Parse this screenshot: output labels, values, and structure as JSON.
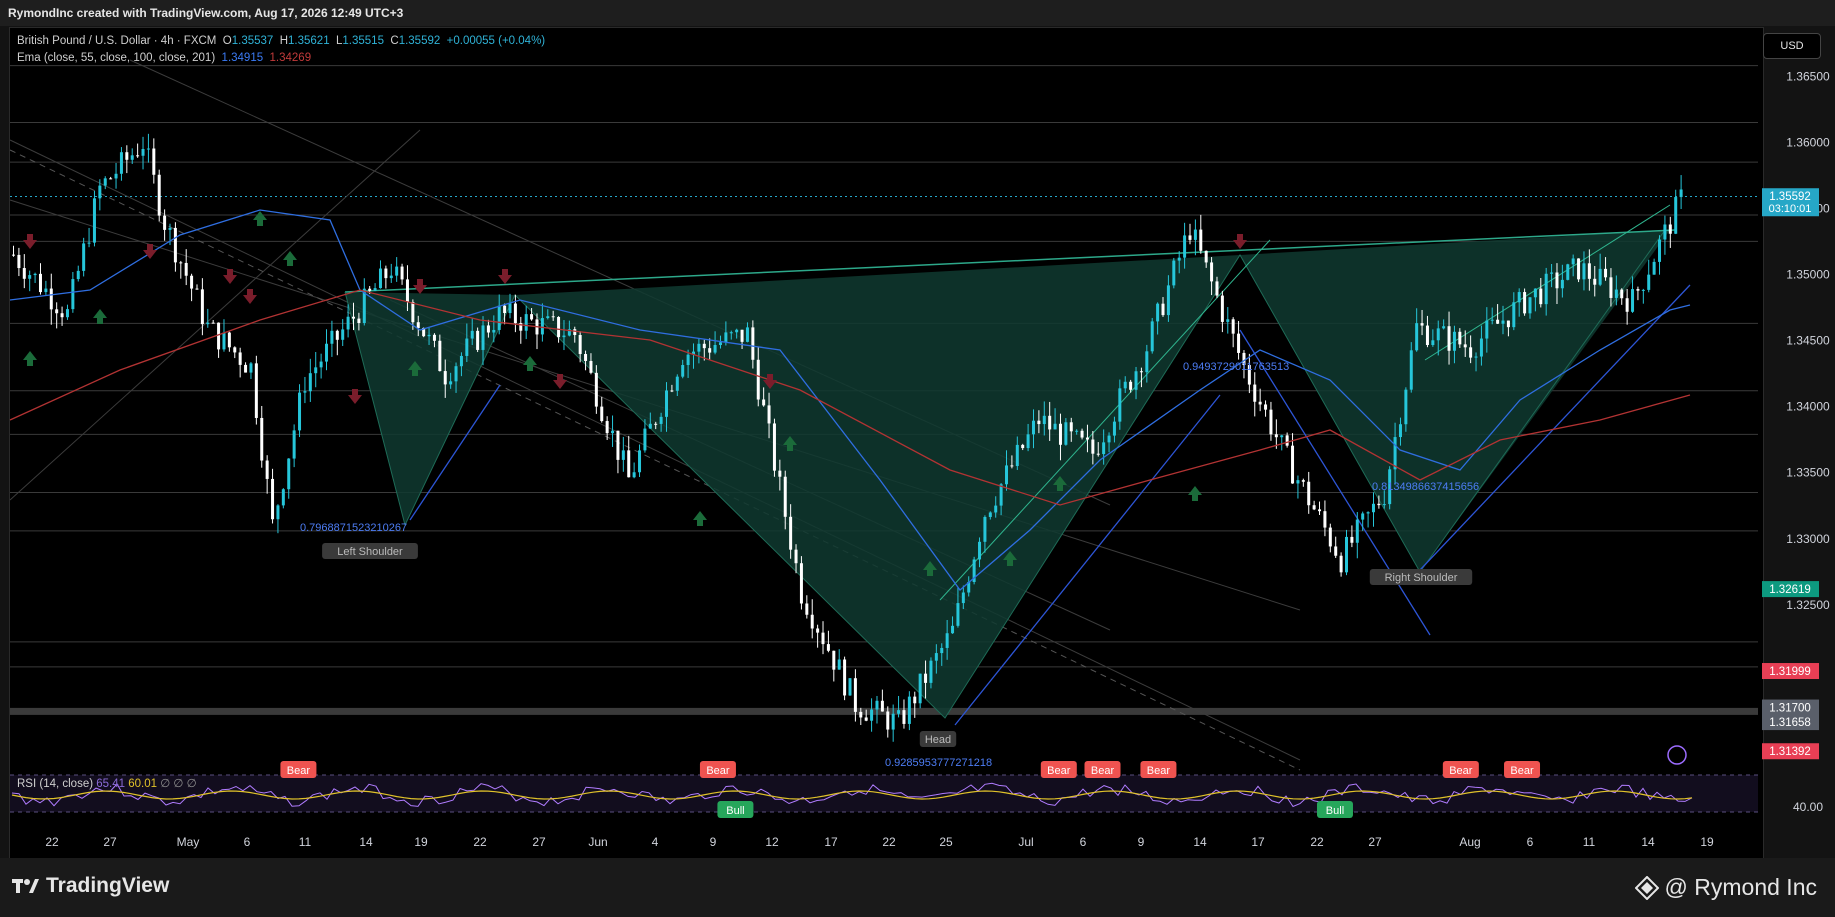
{
  "header": {
    "credit": "RymondInc created with TradingView.com, Aug 17, 2026 12:49 UTC+3",
    "symbol": "British Pound / U.S. Dollar · 4h · FXCM",
    "o_label": "O",
    "o_value": "1.35537",
    "h_label": "H",
    "h_value": "1.35621",
    "l_label": "L",
    "l_value": "1.35515",
    "c_label": "C",
    "c_value": "1.35592",
    "change": "+0.00055 (+0.04%)",
    "ema_label": "Ema (close, 55, close, 100, close, 201)",
    "ema_val1": "1.34915",
    "ema_val2": "1.34269",
    "currency_button": "USD"
  },
  "footer": {
    "brand": "TradingView",
    "author": "@ Rymond Inc"
  },
  "colors": {
    "background": "#000000",
    "up_candle": "#26c6da",
    "down_candle": "#ffffff",
    "pattern_fill": "#0f3a30",
    "ema55": "#2f6ee0",
    "ema201": "#b23333",
    "bear_label": "#ef5350",
    "bull_label": "#26a65b",
    "rsi_line": "#b07cff",
    "rsi_ma": "#e0c22a"
  },
  "chart_data": {
    "type": "candlestick",
    "title": "British Pound / U.S. Dollar · 4h · FXCM",
    "x_ticks": [
      "22",
      "27",
      "May",
      "6",
      "11",
      "14",
      "19",
      "22",
      "27",
      "Jun",
      "4",
      "9",
      "12",
      "17",
      "22",
      "25",
      "Jul",
      "6",
      "9",
      "14",
      "17",
      "22",
      "27",
      "Aug",
      "6",
      "11",
      "14",
      "19"
    ],
    "y_ticks": [
      "1.36500",
      "1.36000",
      "1.35500",
      "1.35000",
      "1.34500",
      "1.34000",
      "1.33500",
      "1.33000",
      "1.32500"
    ],
    "ylim": [
      1.3125,
      1.3685
    ],
    "price_tags": [
      {
        "price": 1.35592,
        "label": "1.35592",
        "sub": "03:10:01",
        "color": "#26a7c7"
      },
      {
        "price": 1.32619,
        "label": "1.32619",
        "color": "#0d9a80"
      },
      {
        "price": 1.31999,
        "label": "1.31999",
        "color": "#e83f55"
      },
      {
        "price": 1.317,
        "label": "1.31700",
        "color": "#5a5f6a"
      },
      {
        "price": 1.31658,
        "label": "1.31658",
        "color": "#5a5f6a"
      },
      {
        "price": 1.31392,
        "label": "1.31392",
        "color": "#e83f55"
      }
    ],
    "pattern": {
      "name": "Inverse Head and Shoulders",
      "points": [
        {
          "label": "Left Shoulder",
          "date": "May 16",
          "price": 1.331,
          "ratio": "0.7968871523210267"
        },
        {
          "date": "May 24",
          "price": 1.3508
        },
        {
          "label": "Head",
          "date": "Jun 24",
          "price": 1.3152,
          "ratio": "0.9285953777271218"
        },
        {
          "date": "Jul 16",
          "price": 1.3535,
          "ratio": "0.9493729011763513"
        },
        {
          "label": "Right Shoulder",
          "date": "Jul 29",
          "price": 1.3285,
          "ratio": "0.8134986637415656"
        }
      ]
    },
    "indicators": [
      "EMA 55",
      "EMA 201"
    ],
    "rsi": {
      "label": "RSI (14, close)",
      "value1": "65.41",
      "value2": "60.01",
      "extra": "∅ ∅ ∅",
      "axis_tick": "40.00",
      "signals": [
        {
          "type": "Bear",
          "x": 0.165
        },
        {
          "type": "Bear",
          "x": 0.405
        },
        {
          "type": "Bull",
          "x": 0.415
        },
        {
          "type": "Bear",
          "x": 0.6
        },
        {
          "type": "Bear",
          "x": 0.625
        },
        {
          "type": "Bear",
          "x": 0.657
        },
        {
          "type": "Bull",
          "x": 0.758
        },
        {
          "type": "Bear",
          "x": 0.83
        },
        {
          "type": "Bear",
          "x": 0.865
        }
      ]
    }
  }
}
